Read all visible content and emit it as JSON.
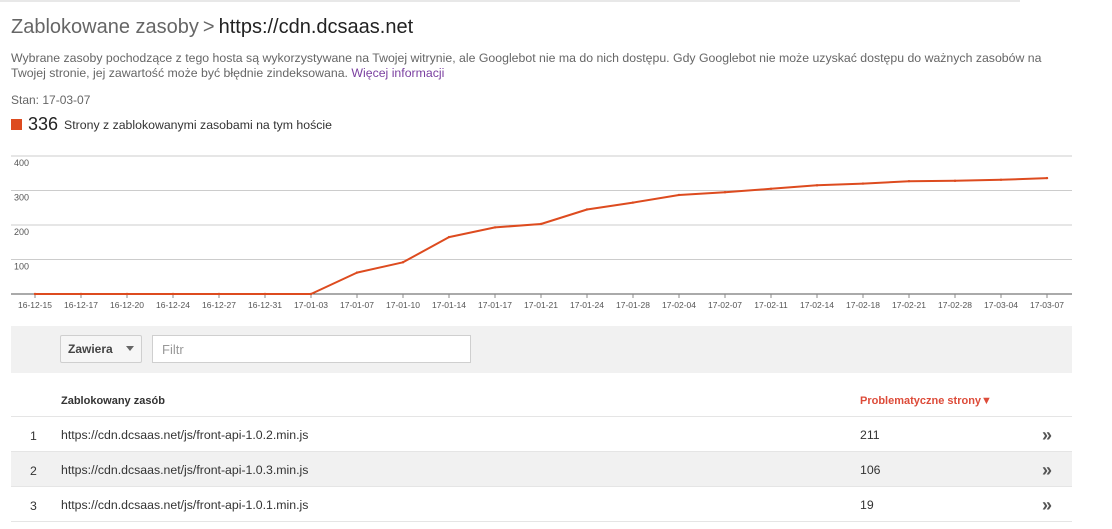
{
  "header": {
    "parent": "Zablokowane zasoby",
    "separator": ">",
    "current": "https://cdn.dcsaas.net"
  },
  "description": {
    "text": "Wybrane zasoby pochodzące z tego hosta są wykorzystywane na Twojej witrynie, ale Googlebot nie ma do nich dostępu. Gdy Googlebot nie może uzyskać dostępu do ważnych zasobów na Twojej stronie, jej zawartość może być błędnie zindeksowana.",
    "link": "Więcej informacji"
  },
  "status": "Stan: 17-03-07",
  "legend": {
    "count": "336",
    "label": "Strony z zablokowanymi zasobami na tym hoście",
    "color": "#dd4b1f"
  },
  "chart_data": {
    "type": "line",
    "x": [
      "16-12-15",
      "16-12-17",
      "16-12-20",
      "16-12-24",
      "16-12-27",
      "16-12-31",
      "17-01-03",
      "17-01-07",
      "17-01-10",
      "17-01-14",
      "17-01-17",
      "17-01-21",
      "17-01-24",
      "17-01-28",
      "17-02-04",
      "17-02-07",
      "17-02-11",
      "17-02-14",
      "17-02-18",
      "17-02-21",
      "17-02-28",
      "17-03-04",
      "17-03-07"
    ],
    "series": [
      {
        "values": [
          0,
          0,
          0,
          0,
          0,
          0,
          0,
          62,
          92,
          165,
          193,
          203,
          245,
          265,
          287,
          295,
          305,
          315,
          320,
          327,
          328,
          331,
          336
        ],
        "color": "#dd4b1f"
      }
    ],
    "yticks": [
      100,
      200,
      300,
      400
    ],
    "ylim": [
      0,
      400
    ],
    "grid": true
  },
  "filter": {
    "mode": "Zawiera",
    "placeholder": "Filtr"
  },
  "table": {
    "headers": {
      "resource": "Zablokowany zasób",
      "pages": "Problematyczne strony▼"
    },
    "rows": [
      {
        "num": "1",
        "url": "https://cdn.dcsaas.net/js/front-api-1.0.2.min.js",
        "count": "211",
        "chevron": "»"
      },
      {
        "num": "2",
        "url": "https://cdn.dcsaas.net/js/front-api-1.0.3.min.js",
        "count": "106",
        "chevron": "»"
      },
      {
        "num": "3",
        "url": "https://cdn.dcsaas.net/js/front-api-1.0.1.min.js",
        "count": "19",
        "chevron": "»"
      }
    ]
  }
}
